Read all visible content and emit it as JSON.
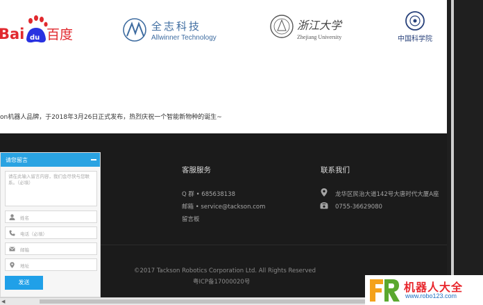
{
  "partners": [
    {
      "name": "Baidu",
      "latin": "Bai",
      "mark": "du",
      "cn": "百度"
    },
    {
      "name": "Allwinner",
      "cn": "全志科技",
      "en": "Allwinner Technology"
    },
    {
      "name": "Zhejiang University",
      "cn": "浙江大学",
      "en": "Zhejiang University"
    },
    {
      "name": "CAS",
      "cn": "中国科学院"
    }
  ],
  "intro": "on机器人品牌，于2018年3月26日正式发布，热烈庆祝一个智能新物种的诞生~",
  "footer": {
    "service": {
      "title": "客服服务",
      "qq": "Q 群 • 685638138",
      "email": "邮箱 • service@tackson.com",
      "guestbook": "留言板"
    },
    "contact": {
      "title": "联系我们",
      "address": "龙华区民治大道142号大唐时代大厦A座",
      "phone": "0755-36629080"
    },
    "copyright": "©2017 Tackson Robotics Corporation Ltd. All Rights Reserved",
    "icp": "粤ICP备17000020号"
  },
  "widget": {
    "title": "请您留言",
    "textarea_placeholder": "请在此输入留言内容，我们会尽快与您联系。（必填）",
    "name_placeholder": "姓名",
    "phone_placeholder": "电话（必填）",
    "email_placeholder": "邮箱",
    "address_placeholder": "地址",
    "send_label": "发送"
  },
  "watermark": {
    "name": "机器人大全",
    "url": "www.robo123.com"
  },
  "colors": {
    "accent": "#2aa3e2",
    "footer_bg": "#1b1b1b",
    "baidu_red": "#e1292e",
    "baidu_blue": "#2932e1"
  }
}
